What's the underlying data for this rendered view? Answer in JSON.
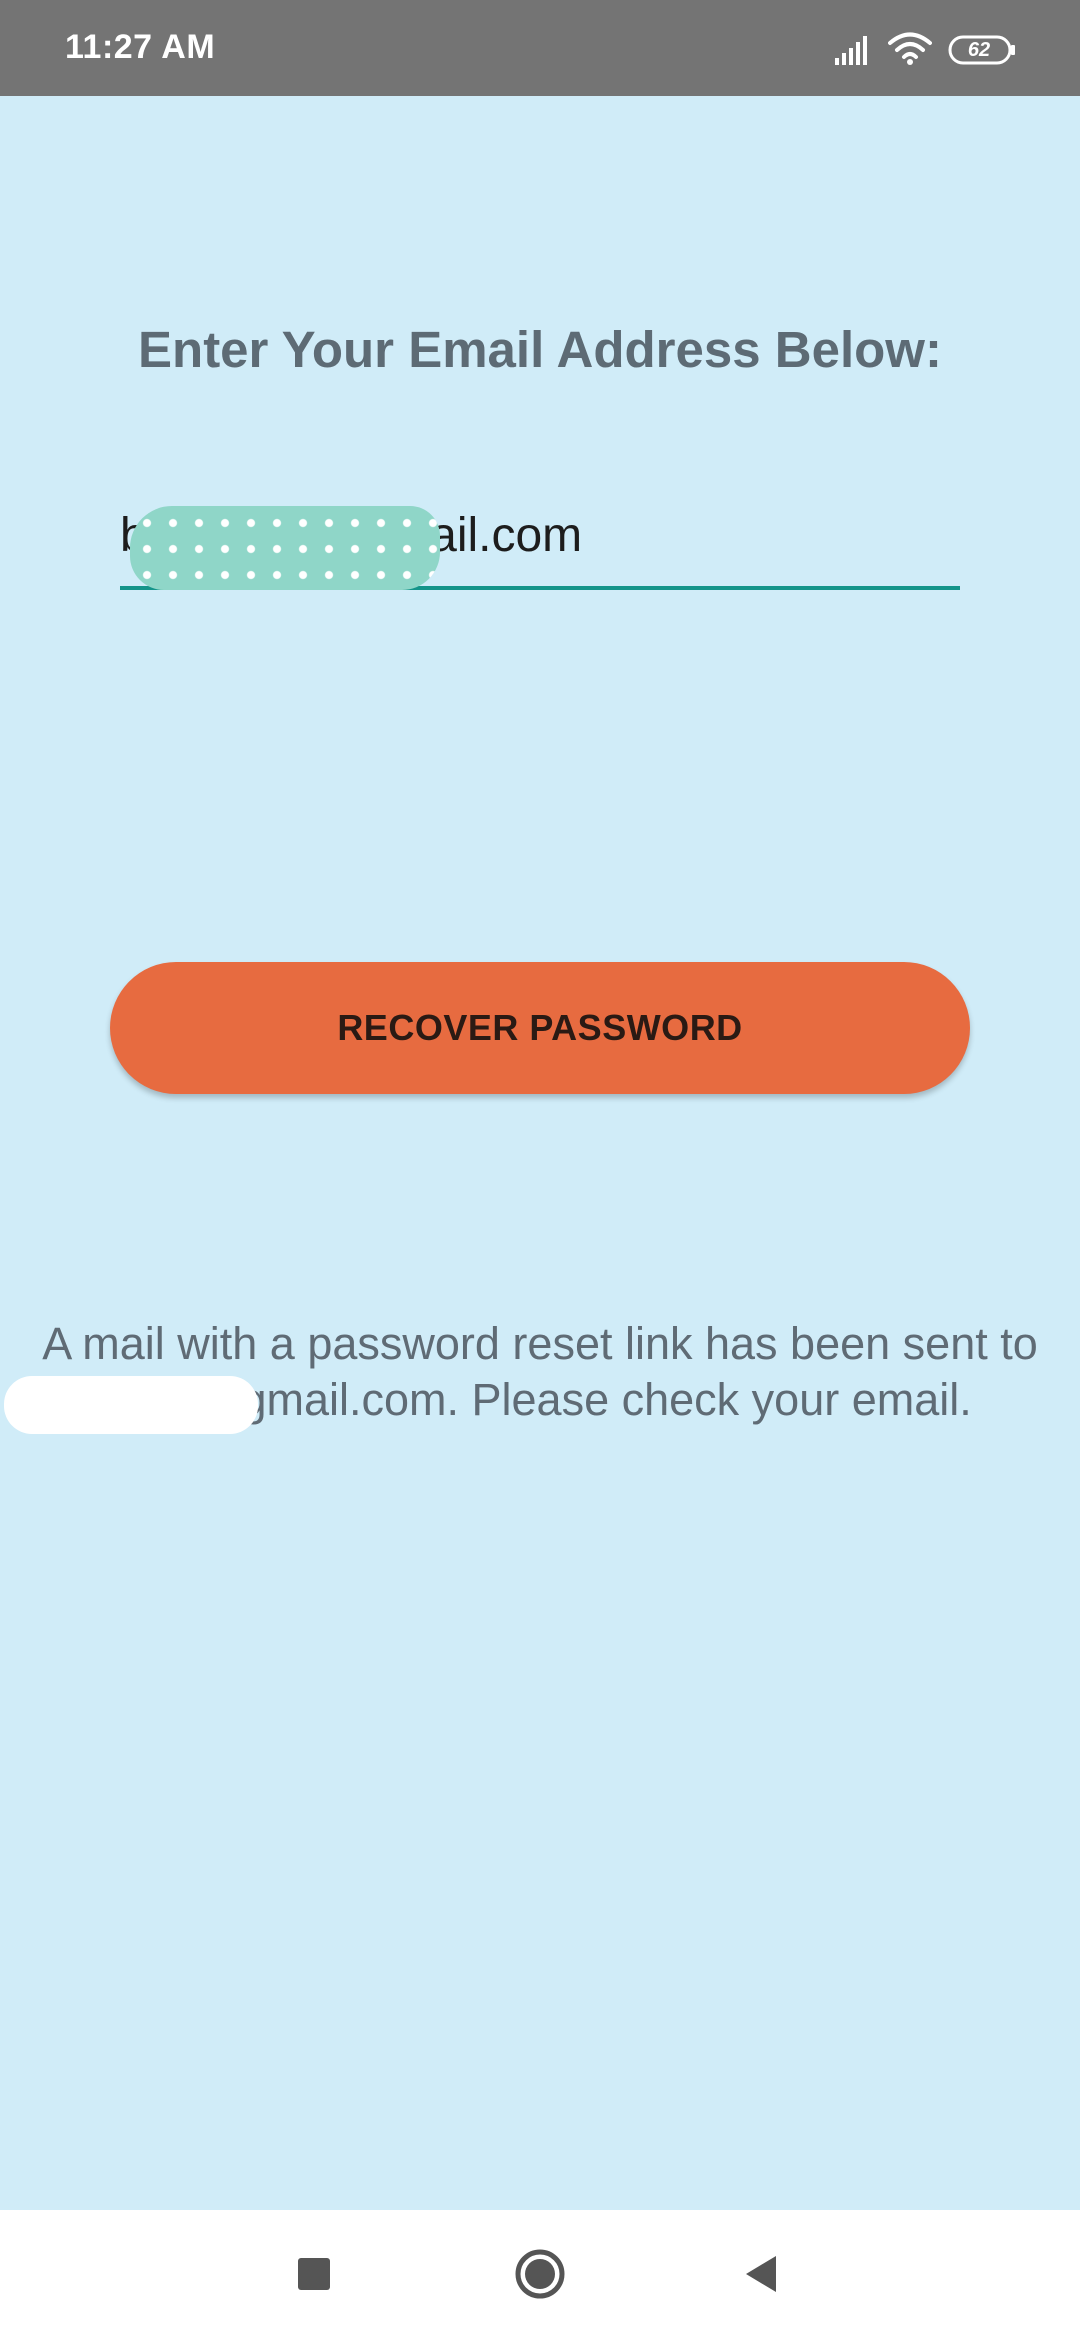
{
  "status_bar": {
    "time": "11:27 AM",
    "battery": "62",
    "icons": [
      "signal-icon",
      "wifi-icon",
      "battery-icon"
    ]
  },
  "recover_screen": {
    "title": "Enter Your Email Address Below:",
    "email_value": "b          il @gmail.com",
    "button_label": "RECOVER PASSWORD",
    "message_line1": "A mail with a password reset link has been sent to",
    "message_line2": "@gmail.com. Please check your email."
  },
  "nav_bar": {
    "icons": [
      "recents-icon",
      "home-icon",
      "back-icon"
    ]
  },
  "colors": {
    "background": "#d0ecf8",
    "status_bar": "#747474",
    "accent": "#14948a",
    "button": "#e76b40",
    "text_muted": "#5d6b75"
  }
}
